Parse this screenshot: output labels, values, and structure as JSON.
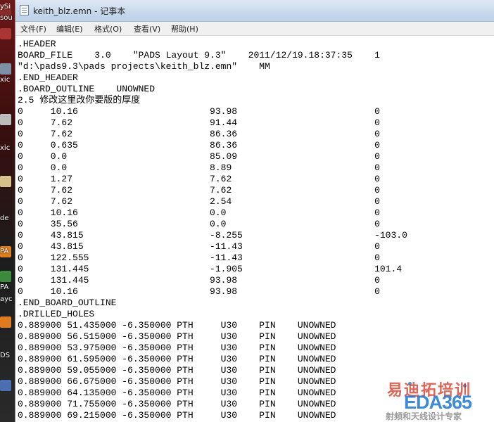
{
  "desktop": {
    "labels": [
      "ySi",
      "sou",
      "xic",
      "xic",
      "de",
      "PA",
      "PA",
      "ayc",
      "DS"
    ]
  },
  "window": {
    "title": "keith_blz.emn - 记事本",
    "menu": [
      "文件(F)",
      "编辑(E)",
      "格式(O)",
      "查看(V)",
      "帮助(H)"
    ]
  },
  "document": {
    "text": ".HEADER\nBOARD_FILE    3.0    \"PADS Layout 9.3\"    2011/12/19.18:37:35    1\n\"d:\\pads9.3\\pads projects\\keith_blz.emn\"    MM\n.END_HEADER\n.BOARD_OUTLINE    UNOWNED\n2.5 修改这里改你要版的厚度\n0     10.16                        93.98                         0\n0     7.62                         91.44                         0\n0     7.62                         86.36                         0\n0     0.635                        86.36                         0\n0     0.0                          85.09                         0\n0     0.0                          8.89                          0\n0     1.27                         7.62                          0\n0     7.62                         7.62                          0\n0     7.62                         2.54                          0\n0     10.16                        0.0                           0\n0     35.56                        0.0                           0\n0     43.815                       -8.255                        -103.0\n0     43.815                       -11.43                        0\n0     122.555                      -11.43                        0\n0     131.445                      -1.905                        101.4\n0     131.445                      93.98                         0\n0     10.16                        93.98                         0\n.END_BOARD_OUTLINE\n.DRILLED_HOLES\n0.889000 51.435000 -6.350000 PTH     U30    PIN    UNOWNED\n0.889000 56.515000 -6.350000 PTH     U30    PIN    UNOWNED\n0.889000 53.975000 -6.350000 PTH     U30    PIN    UNOWNED\n0.889000 61.595000 -6.350000 PTH     U30    PIN    UNOWNED\n0.889000 59.055000 -6.350000 PTH     U30    PIN    UNOWNED\n0.889000 66.675000 -6.350000 PTH     U30    PIN    UNOWNED\n0.889000 64.135000 -6.350000 PTH     U30    PIN    UNOWNED\n0.889000 71.755000 -6.350000 PTH     U30    PIN    UNOWNED\n0.889000 69.215000 -6.350000 PTH     U30    PIN    UNOWNED"
  },
  "watermark": {
    "cn_top": "易迪拓培训",
    "brand": "EDA365",
    "tagline": "射频和天线设计专家"
  }
}
